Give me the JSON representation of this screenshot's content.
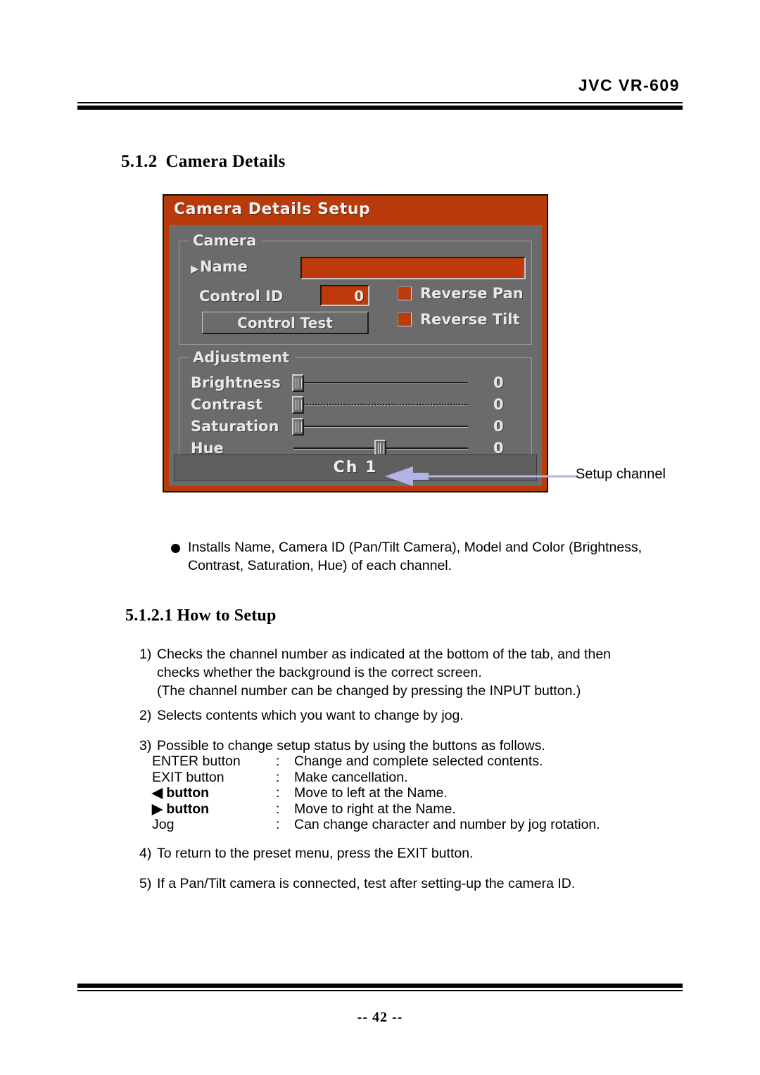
{
  "header": {
    "title": "JVC VR-609"
  },
  "headings": {
    "section_number": "5.1.2",
    "section_title": "Camera Details",
    "subsection_number": "5.1.2.1",
    "subsection_title": "How to Setup"
  },
  "osd": {
    "title": "Camera Details Setup",
    "camera_group": {
      "legend": "Camera",
      "name_label": "Name",
      "name_marker": "▶",
      "name_value": "",
      "control_id_label": "Control ID",
      "control_id_value": "0",
      "control_test_label": "Control Test",
      "reverse_pan_label": "Reverse Pan",
      "reverse_tilt_label": "Reverse Tilt"
    },
    "adjustment_group": {
      "legend": "Adjustment",
      "sliders": [
        {
          "label": "Brightness",
          "value": "0",
          "percent": 0
        },
        {
          "label": "Contrast",
          "value": "0",
          "percent": 0
        },
        {
          "label": "Saturation",
          "value": "0",
          "percent": 0
        },
        {
          "label": "Hue",
          "value": "0",
          "percent": 50
        }
      ]
    },
    "channel_tab": "Ch 1",
    "colors": {
      "title_bar": "#b93a0a",
      "field_highlight": "#bf3a0a",
      "panel_body": "#6b6b6b",
      "channel_tab": "#5f5f5f",
      "callout_arrow": "#b3b3e6"
    }
  },
  "callout": {
    "label": "Setup channel"
  },
  "bullet": {
    "text": "Installs  Name, Camera ID (Pan/Tilt Camera), Model and Color (Brightness,\nContrast,  Saturation, Hue) of each channel."
  },
  "steps": [
    {
      "marker": "1)",
      "text": "Checks the channel number as indicated at the bottom of the tab, and then\nchecks whether the background is the correct screen.\n(The channel number can be changed by pressing the INPUT button.)"
    },
    {
      "marker": "2)",
      "text": "Selects contents which you want to change by jog."
    },
    {
      "marker": "3)",
      "text": "Possible to change setup status by using the buttons as follows."
    },
    {
      "marker": "4)",
      "text": "To return to the preset menu, press the EXIT button."
    },
    {
      "marker": "5)",
      "text": "If a Pan/Tilt camera is connected, test after setting-up the camera ID."
    }
  ],
  "key_table": {
    "separator": ":",
    "rows": [
      {
        "key": "ENTER button",
        "desc": "Change and complete selected contents."
      },
      {
        "key": "EXIT button",
        "desc": "Make cancellation."
      },
      {
        "key": "◀ button",
        "desc": "Move to left at the  Name."
      },
      {
        "key": "▶ button",
        "desc": "Move to right at the Name."
      },
      {
        "key": "Jog",
        "desc": "Can change character and number by jog rotation."
      }
    ]
  },
  "footer": {
    "page_number": "-- 42 --"
  }
}
